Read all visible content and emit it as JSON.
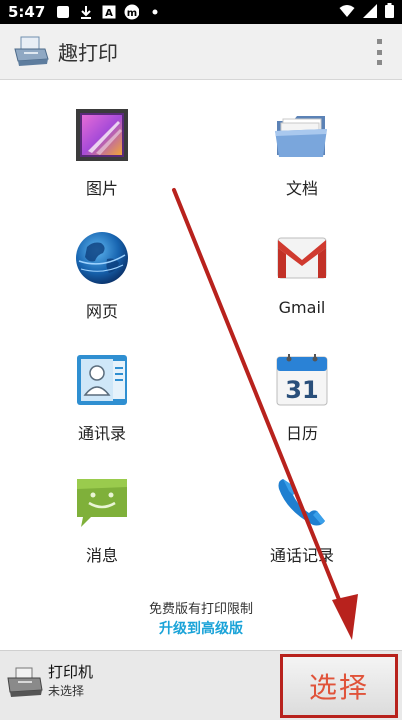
{
  "status_bar": {
    "time": "5:47",
    "icons_left": [
      "white-square-icon",
      "download-icon",
      "a-badge-icon",
      "m-badge-icon",
      "dot-icon"
    ],
    "icons_right": [
      "wifi-icon",
      "signal-icon",
      "battery-icon"
    ]
  },
  "app_bar": {
    "title": "趣打印"
  },
  "grid": {
    "items": [
      {
        "label": "图片",
        "icon": "picture-icon"
      },
      {
        "label": "文档",
        "icon": "folder-icon"
      },
      {
        "label": "网页",
        "icon": "globe-icon"
      },
      {
        "label": "Gmail",
        "icon": "gmail-icon"
      },
      {
        "label": "通讯录",
        "icon": "contacts-icon"
      },
      {
        "label": "日历",
        "icon": "calendar-icon"
      },
      {
        "label": "消息",
        "icon": "message-icon"
      },
      {
        "label": "通话记录",
        "icon": "phone-icon"
      }
    ]
  },
  "calendar_day": "31",
  "footer": {
    "limit_note": "免费版有打印限制",
    "upgrade_link": "升级到高级版"
  },
  "bottom_bar": {
    "printer_name": "打印机",
    "printer_status": "未选择",
    "select_label": "选择"
  },
  "colors": {
    "accent_link": "#1aa3d8",
    "annotation_red": "#b8221d"
  }
}
